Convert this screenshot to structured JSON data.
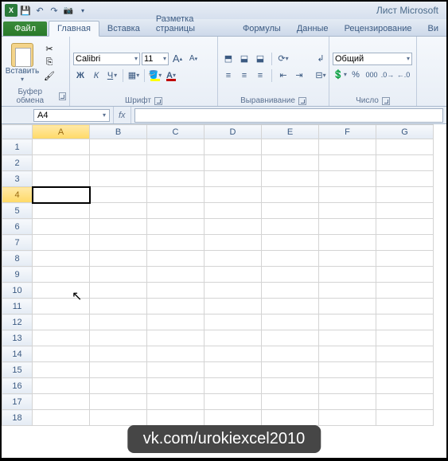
{
  "title": "Лист Microsoft",
  "tabs": {
    "file": "Файл",
    "items": [
      "Главная",
      "Вставка",
      "Разметка страницы",
      "Формулы",
      "Данные",
      "Рецензирование",
      "Ви"
    ],
    "active": 0
  },
  "ribbon": {
    "clipboard": {
      "label": "Буфер обмена",
      "paste": "Вставить"
    },
    "font": {
      "label": "Шрифт",
      "name": "Calibri",
      "size": "11",
      "increase": "A",
      "decrease": "A",
      "bold": "Ж",
      "italic": "К",
      "underline": "Ч",
      "fill_color": "#ffff00",
      "text_color": "#c00000"
    },
    "alignment": {
      "label": "Выравнивание"
    },
    "number": {
      "label": "Число",
      "format": "Общий",
      "percent": "%",
      "comma": "000"
    }
  },
  "nameBox": "A4",
  "fx": "fx",
  "columns": [
    "A",
    "B",
    "C",
    "D",
    "E",
    "F",
    "G"
  ],
  "rows": [
    "1",
    "2",
    "3",
    "4",
    "5",
    "6",
    "7",
    "8",
    "9",
    "10",
    "11",
    "12",
    "13",
    "14",
    "15",
    "16",
    "17",
    "18"
  ],
  "selected": {
    "col": "A",
    "row": "4"
  },
  "watermark": "vk.com/urokiexcel2010"
}
